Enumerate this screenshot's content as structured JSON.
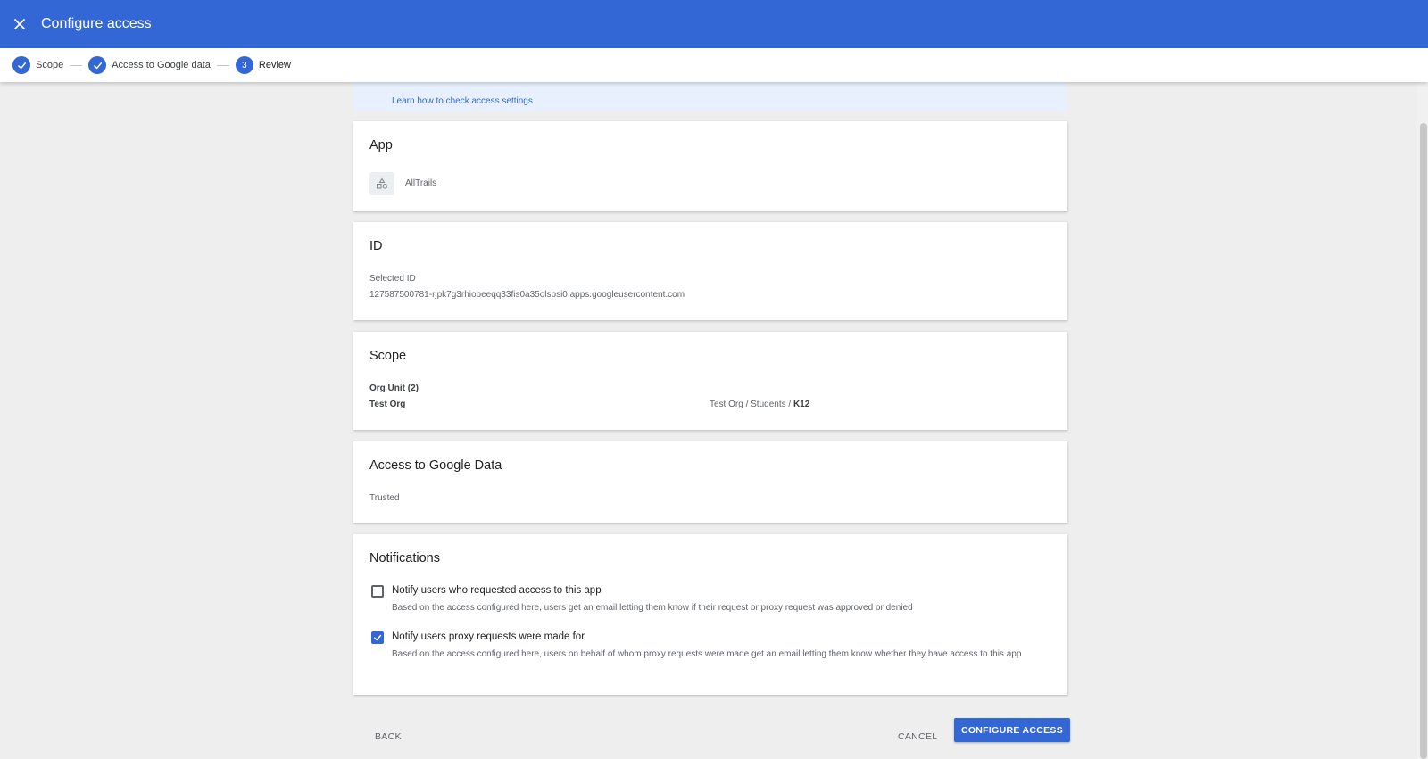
{
  "header": {
    "title": "Configure access"
  },
  "stepper": {
    "steps": [
      {
        "label": "Scope"
      },
      {
        "label": "Access to Google data"
      },
      {
        "number": "3",
        "label": "Review"
      }
    ]
  },
  "banner": {
    "link_text": "Learn how to check access settings"
  },
  "app_card": {
    "title": "App",
    "app_name": "AllTrails"
  },
  "id_card": {
    "title": "ID",
    "selected_label": "Selected ID",
    "selected_value": "127587500781-rjpk7g3rhiobeeqq33fis0a35olspsi0.apps.googleusercontent.com"
  },
  "scope_card": {
    "title": "Scope",
    "org_unit_label": "Org Unit (2)",
    "org_name": "Test Org",
    "path_prefix": "Test Org / Students / ",
    "path_last": "K12"
  },
  "access_card": {
    "title": "Access to Google Data",
    "value": "Trusted"
  },
  "notifications_card": {
    "title": "Notifications",
    "options": [
      {
        "label": "Notify users who requested access to this app",
        "description": "Based on the access configured here, users get an email letting them know if their request or proxy request was approved or denied",
        "checked": false
      },
      {
        "label": "Notify users proxy requests were made for",
        "description": "Based on the access configured here, users on behalf of whom proxy requests were made get an email letting them know whether they have access to this app",
        "checked": true
      }
    ]
  },
  "footer": {
    "back_label": "BACK",
    "cancel_label": "CANCEL",
    "configure_label": "CONFIGURE ACCESS"
  },
  "colors": {
    "accent": "#3367d6",
    "background": "#eeeeee",
    "banner": "#e8f0fe"
  }
}
